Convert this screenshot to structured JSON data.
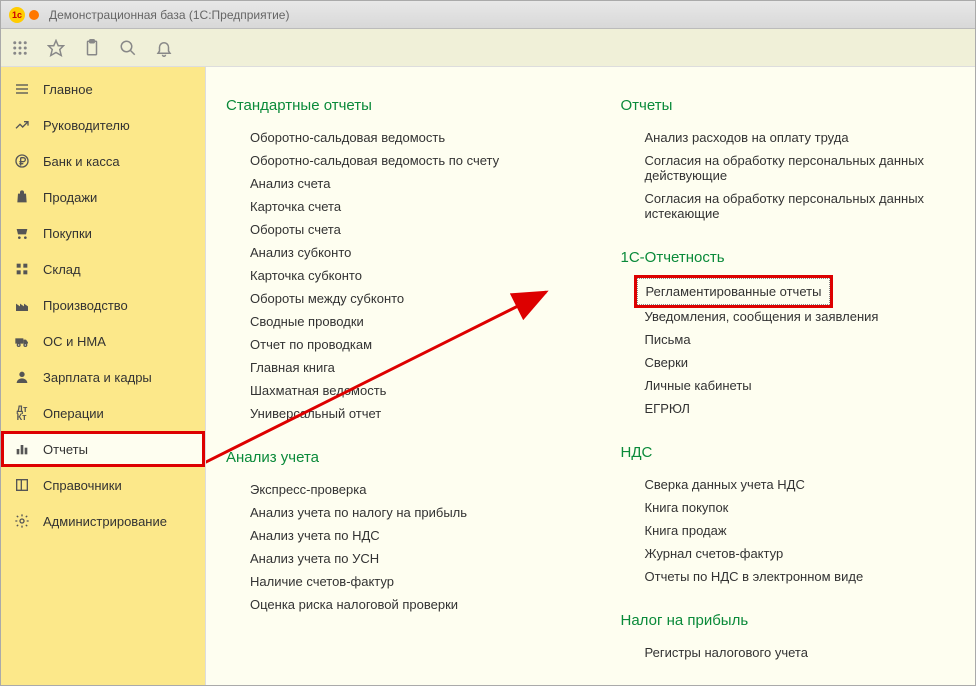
{
  "titlebar": {
    "text": "Демонстрационная база  (1С:Предприятие)"
  },
  "sidebar": {
    "items": [
      {
        "icon": "menu",
        "label": "Главное"
      },
      {
        "icon": "trend",
        "label": "Руководителю"
      },
      {
        "icon": "ruble",
        "label": "Банк и касса"
      },
      {
        "icon": "bag",
        "label": "Продажи"
      },
      {
        "icon": "cart",
        "label": "Покупки"
      },
      {
        "icon": "warehouse",
        "label": "Склад"
      },
      {
        "icon": "factory",
        "label": "Производство"
      },
      {
        "icon": "truck",
        "label": "ОС и НМА"
      },
      {
        "icon": "person",
        "label": "Зарплата и кадры"
      },
      {
        "icon": "dk",
        "label": "Операции"
      },
      {
        "icon": "chart",
        "label": "Отчеты"
      },
      {
        "icon": "book",
        "label": "Справочники"
      },
      {
        "icon": "gear",
        "label": "Администрирование"
      }
    ]
  },
  "columns": [
    [
      {
        "title": "Стандартные отчеты",
        "links": [
          "Оборотно-сальдовая ведомость",
          "Оборотно-сальдовая ведомость по счету",
          "Анализ счета",
          "Карточка счета",
          "Обороты счета",
          "Анализ субконто",
          "Карточка субконто",
          "Обороты между субконто",
          "Сводные проводки",
          "Отчет по проводкам",
          "Главная книга",
          "Шахматная ведомость",
          "Универсальный отчет"
        ]
      },
      {
        "title": "Анализ учета",
        "links": [
          "Экспресс-проверка",
          "Анализ учета по налогу на прибыль",
          "Анализ учета по НДС",
          "Анализ учета по УСН",
          "Наличие счетов-фактур",
          "Оценка риска налоговой проверки"
        ]
      }
    ],
    [
      {
        "title": "Отчеты",
        "links": [
          "Анализ расходов на оплату труда",
          "Согласия на обработку персональных данных действующие",
          "Согласия на обработку персональных данных истекающие"
        ]
      },
      {
        "title": "1С-Отчетность",
        "links": [
          "Регламентированные отчеты",
          "Уведомления, сообщения и заявления",
          "Письма",
          "Сверки",
          "Личные кабинеты",
          "ЕГРЮЛ"
        ]
      },
      {
        "title": "НДС",
        "links": [
          "Сверка данных учета НДС",
          "Книга покупок",
          "Книга продаж",
          "Журнал счетов-фактур",
          "Отчеты по НДС в электронном виде"
        ]
      },
      {
        "title": "Налог на прибыль",
        "links": [
          "Регистры налогового учета"
        ]
      }
    ]
  ]
}
